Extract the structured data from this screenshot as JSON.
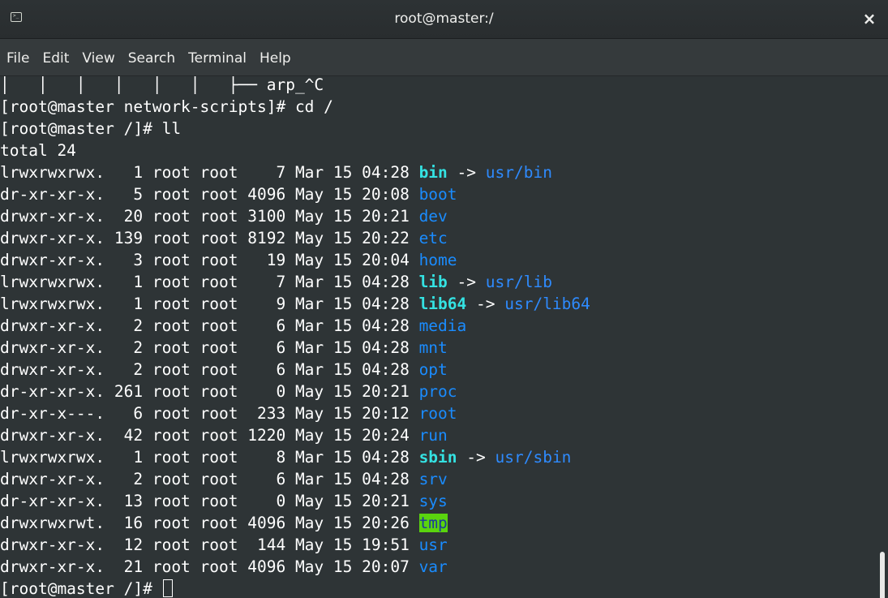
{
  "window": {
    "title": "root@master:/",
    "close_glyph": "×",
    "icon": "terminal-icon",
    "icon_glyph": ">_"
  },
  "menu": [
    "File",
    "Edit",
    "View",
    "Search",
    "Terminal",
    "Help"
  ],
  "terminal": {
    "tree_line": "│   │   │   │   │   │   ├── arp_^C",
    "cmd_cd": "[root@master network-scripts]# cd /",
    "cmd_ll": "[root@master /]# ll",
    "total": "total 24",
    "entries": [
      {
        "meta": "lrwxrwxrwx.   1 root root    7 Mar 15 04:28 ",
        "name": "bin",
        "style": "link",
        "target": "usr/bin"
      },
      {
        "meta": "dr-xr-xr-x.   5 root root 4096 May 15 20:08 ",
        "name": "boot",
        "style": "dir"
      },
      {
        "meta": "drwxr-xr-x.  20 root root 3100 May 15 20:21 ",
        "name": "dev",
        "style": "dir"
      },
      {
        "meta": "drwxr-xr-x. 139 root root 8192 May 15 20:22 ",
        "name": "etc",
        "style": "dir"
      },
      {
        "meta": "drwxr-xr-x.   3 root root   19 May 15 20:04 ",
        "name": "home",
        "style": "dir"
      },
      {
        "meta": "lrwxrwxrwx.   1 root root    7 Mar 15 04:28 ",
        "name": "lib",
        "style": "link",
        "target": "usr/lib"
      },
      {
        "meta": "lrwxrwxrwx.   1 root root    9 Mar 15 04:28 ",
        "name": "lib64",
        "style": "link",
        "target": "usr/lib64"
      },
      {
        "meta": "drwxr-xr-x.   2 root root    6 Mar 15 04:28 ",
        "name": "media",
        "style": "dir"
      },
      {
        "meta": "drwxr-xr-x.   2 root root    6 Mar 15 04:28 ",
        "name": "mnt",
        "style": "dir"
      },
      {
        "meta": "drwxr-xr-x.   2 root root    6 Mar 15 04:28 ",
        "name": "opt",
        "style": "dir"
      },
      {
        "meta": "dr-xr-xr-x. 261 root root    0 May 15 20:21 ",
        "name": "proc",
        "style": "dir"
      },
      {
        "meta": "dr-xr-x---.   6 root root  233 May 15 20:12 ",
        "name": "root",
        "style": "dir"
      },
      {
        "meta": "drwxr-xr-x.  42 root root 1220 May 15 20:24 ",
        "name": "run",
        "style": "dir"
      },
      {
        "meta": "lrwxrwxrwx.   1 root root    8 Mar 15 04:28 ",
        "name": "sbin",
        "style": "link",
        "target": "usr/sbin"
      },
      {
        "meta": "drwxr-xr-x.   2 root root    6 Mar 15 04:28 ",
        "name": "srv",
        "style": "dir"
      },
      {
        "meta": "dr-xr-xr-x.  13 root root    0 May 15 20:21 ",
        "name": "sys",
        "style": "dir"
      },
      {
        "meta": "drwxrwxrwt.  16 root root 4096 May 15 20:26 ",
        "name": "tmp",
        "style": "sticky"
      },
      {
        "meta": "drwxr-xr-x.  12 root root  144 May 15 19:51 ",
        "name": "usr",
        "style": "dir"
      },
      {
        "meta": "drwxr-xr-x.  21 root root 4096 May 15 20:07 ",
        "name": "var",
        "style": "dir"
      }
    ],
    "link_arrow": " -> ",
    "prompt_final": "[root@master /]# "
  },
  "colors": {
    "background": "#2e3436",
    "text": "#ffffff",
    "link_name": "#34e2e2",
    "dir_name": "#1a8cff",
    "sticky_bg": "#5ad40e"
  }
}
